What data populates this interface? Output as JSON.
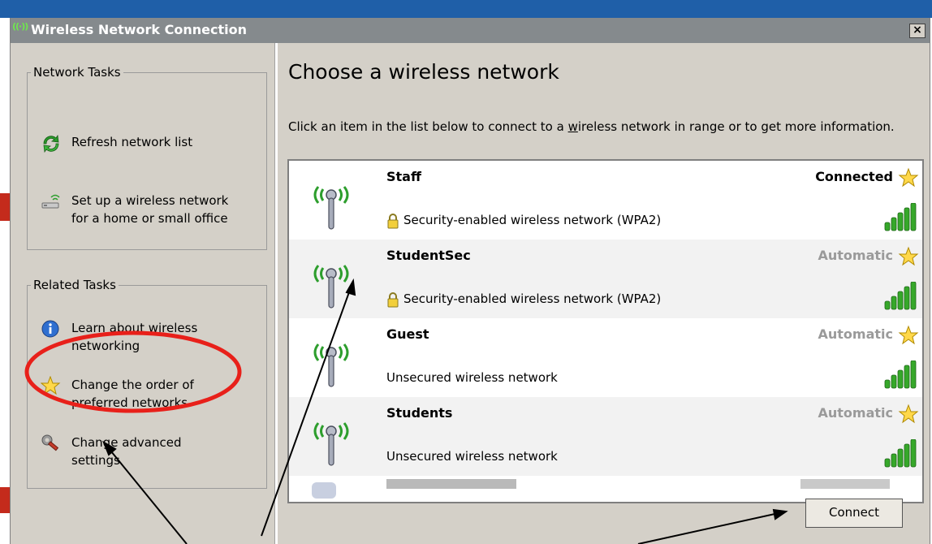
{
  "window": {
    "title": "Wireless Network Connection",
    "title_icon_text": "((·))",
    "close_label": "×"
  },
  "left_pane": {
    "network_tasks": {
      "legend": "Network Tasks",
      "items": [
        {
          "label": "Refresh network list",
          "icon": "refresh-icon"
        },
        {
          "label": "Set up a wireless network\nfor a home or small office",
          "icon": "wireless-setup-icon"
        }
      ]
    },
    "related_tasks": {
      "legend": "Related Tasks",
      "items": [
        {
          "label": "Learn about wireless\nnetworking",
          "icon": "info-icon"
        },
        {
          "label": "Change the order of\npreferred networks",
          "icon": "star-icon"
        },
        {
          "label": "Change advanced\nsettings",
          "icon": "wrench-icon"
        }
      ]
    }
  },
  "main": {
    "heading": "Choose a wireless network",
    "instruction_before": "Click an item in the list below to connect to a ",
    "instruction_underlined": "w",
    "instruction_after": "ireless network in range or to get more information.",
    "networks": [
      {
        "name": "Staff",
        "status": "Connected",
        "security": "Security-enabled wireless network (WPA2)",
        "secured": true,
        "signal_bars": 5,
        "status_color": "#000000"
      },
      {
        "name": "StudentSec",
        "status": "Automatic",
        "security": "Security-enabled wireless network (WPA2)",
        "secured": true,
        "signal_bars": 5,
        "status_color": "#9a9a9a"
      },
      {
        "name": "Guest",
        "status": "Automatic",
        "security": "Unsecured wireless network",
        "secured": false,
        "signal_bars": 5,
        "status_color": "#9a9a9a"
      },
      {
        "name": "Students",
        "status": "Automatic",
        "security": "Unsecured wireless network",
        "secured": false,
        "signal_bars": 5,
        "status_color": "#9a9a9a"
      }
    ],
    "connect_label": "Connect"
  },
  "colors": {
    "titlebar": "#858a8d",
    "window_bg": "#d4d0c8",
    "antenna_green": "#2d9e2d",
    "signal_green": "#36a82a",
    "highlight_circle": "#e8201a"
  }
}
